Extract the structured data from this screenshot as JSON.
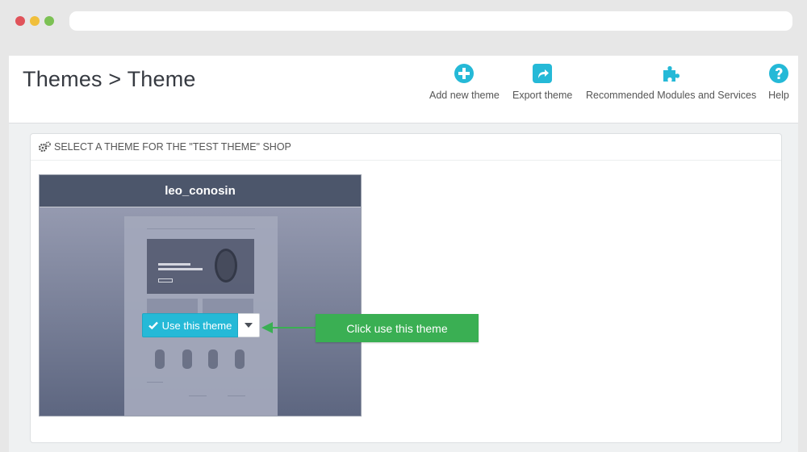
{
  "header": {
    "title": "Themes > Theme",
    "toolbar": [
      {
        "label": "Add new theme",
        "icon": "plus-circle-icon"
      },
      {
        "label": "Export theme",
        "icon": "share-square-icon"
      },
      {
        "label": "Recommended Modules and Services",
        "icon": "puzzle-piece-icon"
      },
      {
        "label": "Help",
        "icon": "question-circle-icon"
      }
    ]
  },
  "panel": {
    "heading": "SELECT A THEME FOR THE \"TEST THEME\" SHOP",
    "theme": {
      "name": "leo_conosin",
      "use_button_label": "Use this theme"
    }
  },
  "annotation": {
    "callout_text": "Click use this theme"
  },
  "colors": {
    "accent": "#25b9d7",
    "callout": "#3aaf53",
    "theme_header": "#4c566b"
  }
}
